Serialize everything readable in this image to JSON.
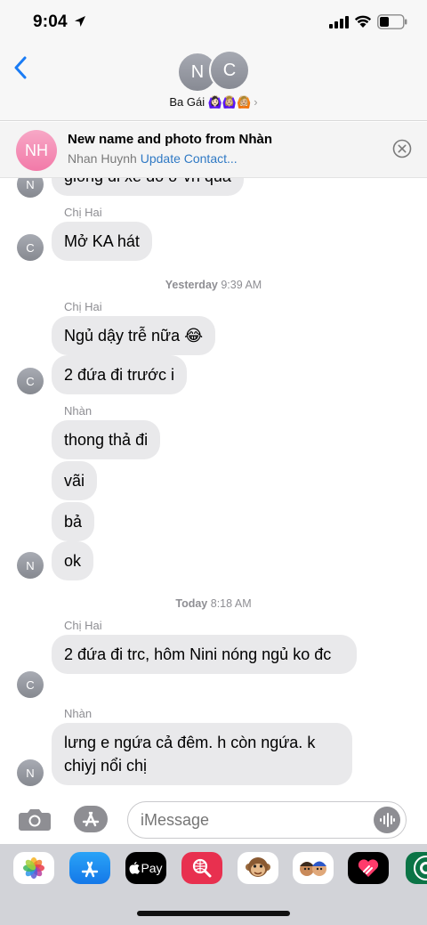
{
  "status_bar": {
    "time": "9:04"
  },
  "header": {
    "avatar_initials": [
      "N",
      "C"
    ],
    "group_name": "Ba Gái 🙆🏻‍♀️🙆🏼‍♀️🙆🏼"
  },
  "banner": {
    "avatar_initials": "NH",
    "title": "New name and photo from Nhàn",
    "contact_name": "Nhan Huynh",
    "update_link": "Update Contact..."
  },
  "thread": {
    "partial_top_text": "giống đi xe đó ở vn quá",
    "groups": [
      {
        "sender": "Chị Hai",
        "avatar": "C",
        "messages": [
          "Mở KA hát"
        ]
      },
      {
        "timestamp_day": "Yesterday",
        "timestamp_time": "9:39 AM"
      },
      {
        "sender": "Chị Hai",
        "avatar": "C",
        "messages": [
          "Ngủ dậy trễ nữa 😂",
          "2 đứa đi trước i"
        ]
      },
      {
        "sender": "Nhàn",
        "avatar": "N",
        "messages": [
          "thong thả đi",
          "vãi",
          "bả",
          "ok"
        ]
      },
      {
        "timestamp_day": "Today",
        "timestamp_time": "8:18 AM"
      },
      {
        "sender": "Chị Hai",
        "avatar": "C",
        "messages": [
          " 2 đứa đi trc, hôm Nini nóng ngủ ko đc"
        ]
      },
      {
        "sender": "Nhàn",
        "avatar": "N",
        "messages": [
          "lưng e ngứa cả đêm. h còn ngứa. k chiyj nổi chị"
        ]
      }
    ]
  },
  "composer": {
    "placeholder": "iMessage"
  },
  "drawer": {
    "apps": [
      "photos",
      "app-store",
      "apple-pay",
      "images-search",
      "animoji",
      "memoji",
      "digital-touch",
      "starbucks"
    ],
    "apple_pay_label": "Pay"
  },
  "colors": {
    "accent": "#1a7cf5",
    "bubble": "#e9e9eb",
    "link": "#2f79c4"
  }
}
